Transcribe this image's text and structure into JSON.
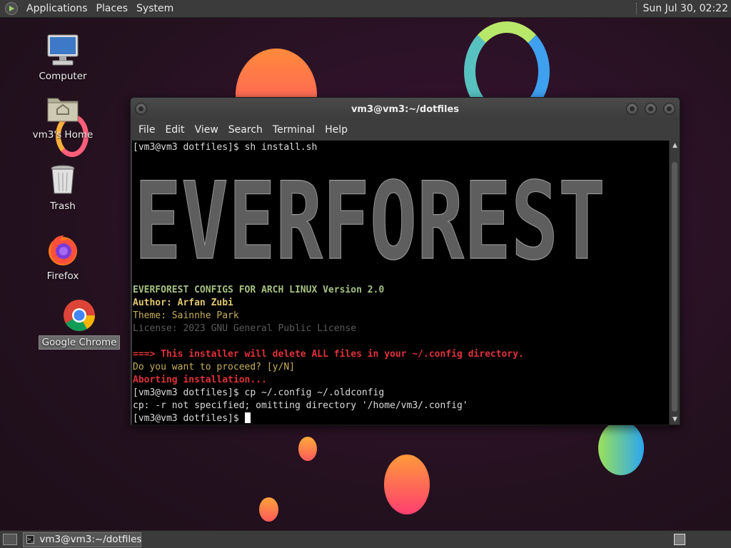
{
  "top_panel": {
    "menus": [
      "Applications",
      "Places",
      "System"
    ],
    "clock": "Sun Jul 30, 02:22"
  },
  "desktop_icons": [
    {
      "label": "Computer",
      "icon": "computer-icon"
    },
    {
      "label": "vm3's Home",
      "icon": "home-folder-icon"
    },
    {
      "label": "Trash",
      "icon": "trash-icon"
    },
    {
      "label": "Firefox",
      "icon": "firefox-icon"
    },
    {
      "label": "Google Chrome",
      "icon": "chrome-icon"
    }
  ],
  "window": {
    "title": "vm3@vm3:~/dotfiles",
    "menu": [
      "File",
      "Edit",
      "View",
      "Search",
      "Terminal",
      "Help"
    ]
  },
  "terminal": {
    "cmd1": "[vm3@vm3 dotfiles]$ sh install.sh",
    "banner": "EVERFOREST",
    "l_configs": "EVERFOREST CONFIGS FOR ARCH LINUX Version 2.0",
    "l_author": "Author: Arfan Zubi",
    "l_theme": "Theme: Sainnhe Park",
    "l_license": "License: 2023 GNU General Public License",
    "l_warn": "===> This installer will delete ALL files in your ~/.config directory.",
    "l_prompt": "Do you want to proceed? [y/N]",
    "l_abort": "Aborting installation...",
    "cmd2": "[vm3@vm3 dotfiles]$ cp ~/.config ~/.oldconfig",
    "l_cp": "cp: -r not specified; omitting directory '/home/vm3/.config'",
    "prompt": "[vm3@vm3 dotfiles]$ "
  },
  "taskbar": {
    "task_label": "vm3@vm3:~/dotfiles"
  }
}
